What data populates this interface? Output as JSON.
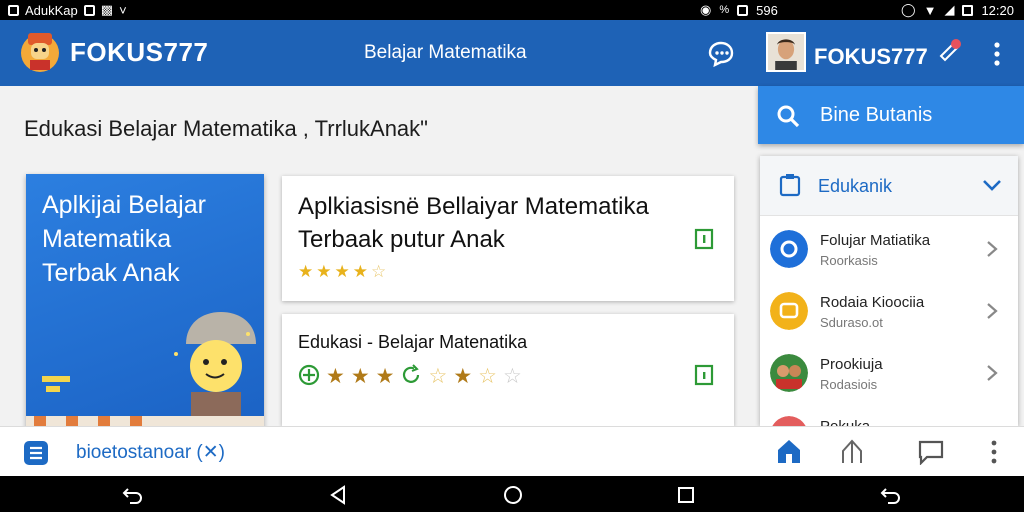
{
  "status_bar": {
    "app_name": "AdukKap",
    "center_text": "596",
    "time": "12:20"
  },
  "app_bar": {
    "brand": "FOKUS777",
    "title": "Belajar Matematika",
    "account_name": "FOKUS777"
  },
  "content": {
    "headline": "Edukasi Belajar Matematika , TrrlukAnak\"",
    "hero": {
      "text": "Aplkijai Belajar Matematika Terbak Anak"
    },
    "card1": {
      "title": "Aplkiasisnë Bellaiyar Matematika Terbaak putur Anak",
      "rating": 4.5
    },
    "card2": {
      "title": "Edukasi - Belajar Matenatika"
    }
  },
  "drawer": {
    "search_label": "Bine Butanis",
    "section_label": "Edukanik",
    "items": [
      {
        "title": "Folujar Matiatika",
        "subtitle": "Roorkasis",
        "color": "#1e6fd9"
      },
      {
        "title": "Rodaia Kioociia",
        "subtitle": "Sduraso.ot",
        "color": "#f2b21a"
      },
      {
        "title": "Prookiuja",
        "subtitle": "Rodasiois",
        "color": "#3b8a3e"
      },
      {
        "title": "Pokuka",
        "subtitle": "",
        "color": "#e35d5d"
      }
    ]
  },
  "bottom_bar": {
    "text": "bioetostanoar (✕)"
  },
  "colors": {
    "primary": "#1e62b6",
    "accent": "#2e88e6",
    "star": "#e8b21c"
  }
}
